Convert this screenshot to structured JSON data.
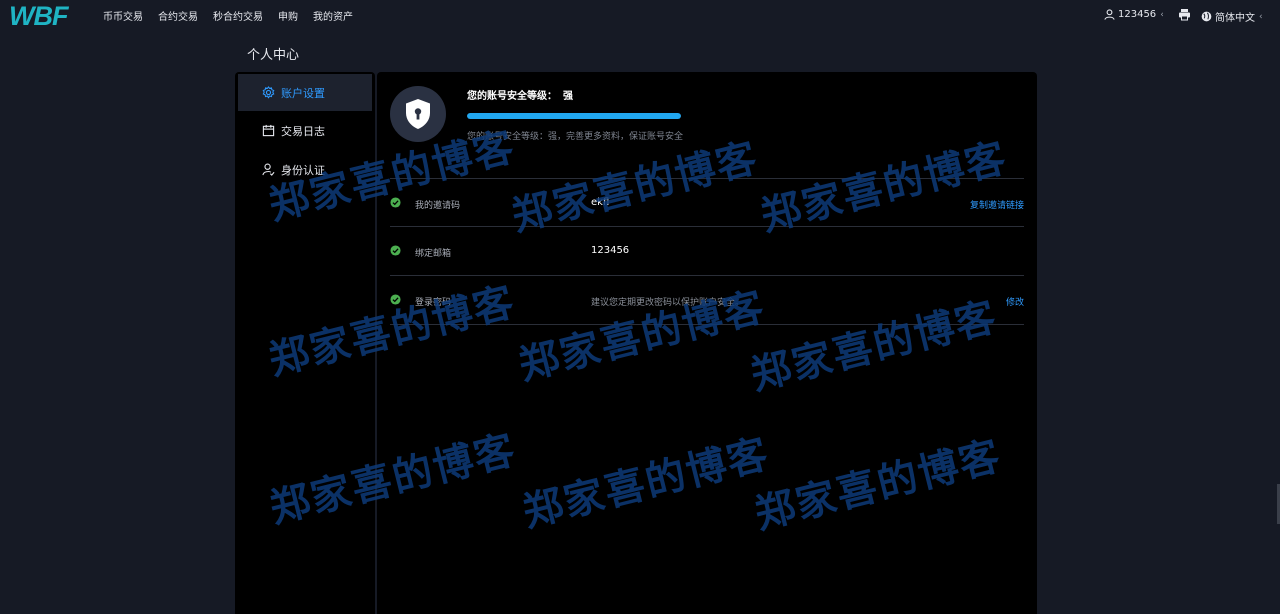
{
  "header": {
    "logo_text": "WBF",
    "nav": [
      "币币交易",
      "合约交易",
      "秒合约交易",
      "申购",
      "我的资产"
    ],
    "username": "123456",
    "language": "简体中文"
  },
  "page_title": "个人中心",
  "sidebar": {
    "items": [
      {
        "label": "账户设置",
        "icon": "gear-icon",
        "active": true
      },
      {
        "label": "交易日志",
        "icon": "calendar-icon",
        "active": false
      },
      {
        "label": "身份认证",
        "icon": "user-verify-icon",
        "active": false
      }
    ]
  },
  "security": {
    "label": "您的账号安全等级：",
    "level": "强",
    "progress": 1.0,
    "tip": "您的账号安全等级：强，完善更多资料，保证账号安全"
  },
  "rows": [
    {
      "label": "我的邀请码",
      "value": "ekfl",
      "action": "复制邀请链接"
    },
    {
      "label": "绑定邮箱",
      "value": "123456",
      "action": ""
    },
    {
      "label": "登录密码",
      "value": "建议您定期更改密码以保护账户安全。",
      "action": "修改"
    }
  ],
  "watermark": "郑家喜的博客",
  "colors": {
    "accent": "#2f9bff",
    "progress": "#21a7f0",
    "check": "#4caf50",
    "watermark": "#0d3a78"
  }
}
